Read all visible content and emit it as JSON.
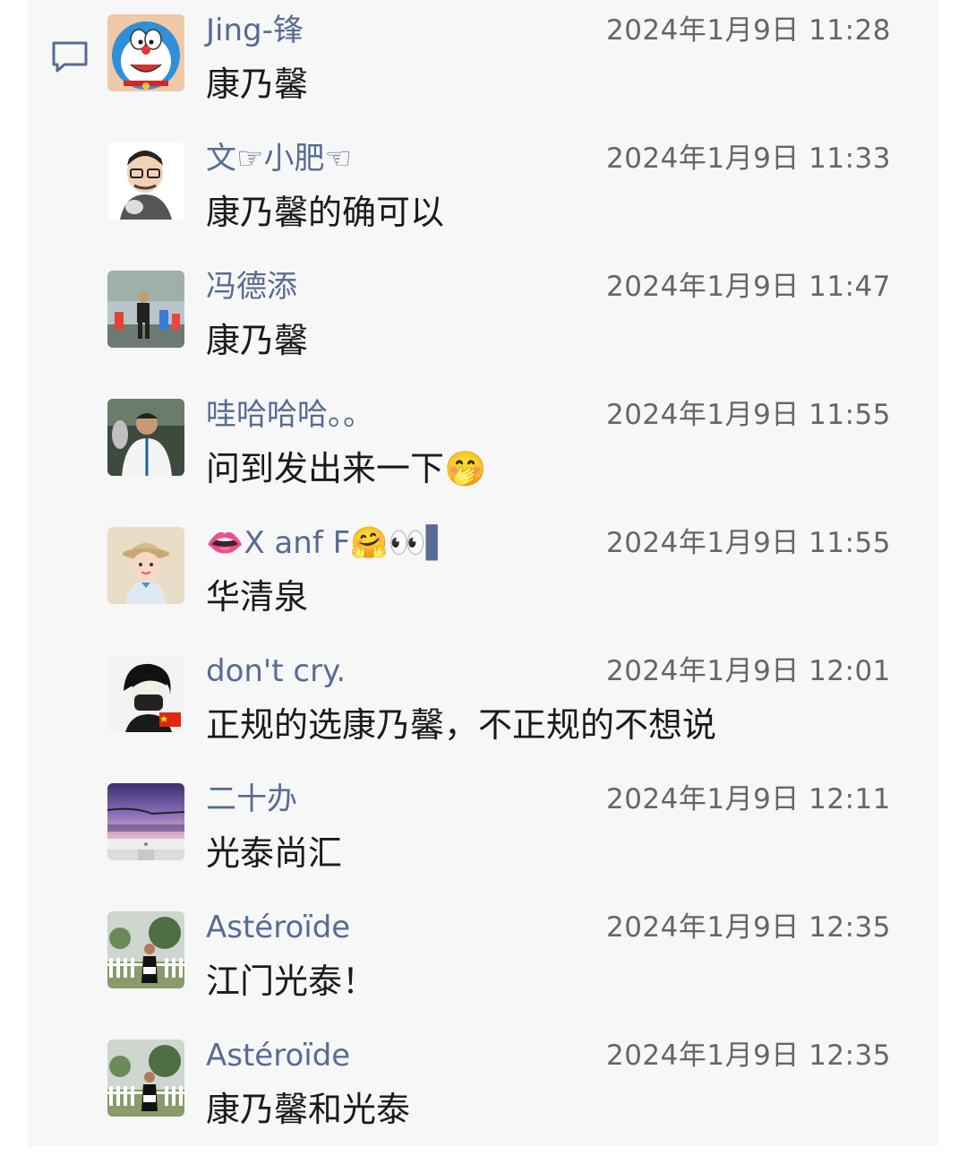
{
  "messages": [
    {
      "name": "Jing-锋",
      "time": "2024年1月9日 11:28",
      "text": "康乃馨",
      "avatar_icon": "doraemon-avatar"
    },
    {
      "name": "文☞小肥☜",
      "time": "2024年1月9日 11:33",
      "text": "康乃馨的确可以",
      "avatar_icon": "cartoon-man-avatar"
    },
    {
      "name": "冯德添",
      "time": "2024年1月9日 11:47",
      "text": "康乃馨",
      "avatar_icon": "runners-photo-avatar"
    },
    {
      "name": "哇哈哈哈。。",
      "time": "2024年1月9日 11:55",
      "text": "问到发出来一下🤭",
      "avatar_icon": "soccer-player-avatar"
    },
    {
      "name": "👄X anf F🤗👀▌",
      "time": "2024年1月9日 11:55",
      "text": "华清泉",
      "avatar_icon": "baby-photo-avatar"
    },
    {
      "name": "don't cry.",
      "time": "2024年1月9日 12:01",
      "text": "正规的选康乃馨，不正规的不想说",
      "avatar_icon": "masked-person-avatar"
    },
    {
      "name": "二十办",
      "time": "2024年1月9日 12:11",
      "text": "光泰尚汇",
      "avatar_icon": "imac-sunset-avatar"
    },
    {
      "name": "Astéroïde",
      "time": "2024年1月9日 12:35",
      "text": "江门光泰！",
      "avatar_icon": "garden-woman-avatar"
    },
    {
      "name": "Astéroïde",
      "time": "2024年1月9日 12:35",
      "text": "康乃馨和光泰",
      "avatar_icon": "garden-woman-avatar"
    }
  ],
  "colors": {
    "name": "#576b95",
    "time": "#666666",
    "text": "#1a1a1a",
    "panel": "#f7f7f7"
  }
}
